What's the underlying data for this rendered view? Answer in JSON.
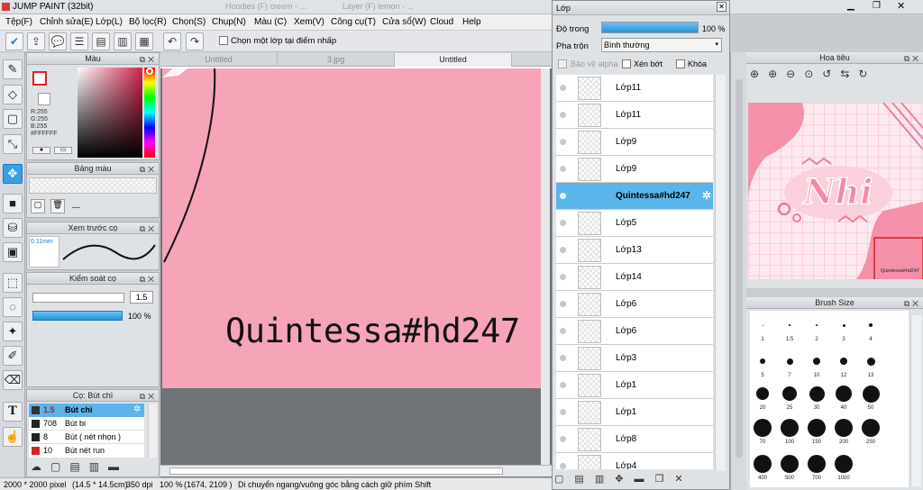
{
  "window": {
    "title": "JUMP PAINT (32bit)"
  },
  "background_tabs": [
    "Hoodies (F) creem - ...",
    "Layer (F) lemon - ..."
  ],
  "menu": [
    "Tệp(F)",
    "Chỉnh sửa(E)",
    "Lớp(L)",
    "Bộ lọc(R)",
    "Chọn(S)",
    "Chụp(N)",
    "Màu (C)",
    "Xem(V)",
    "Công cụ(T)",
    "Cửa sổ(W)",
    "Cloud",
    "Help"
  ],
  "toolbar": {
    "ref_layer_label": "Chọn một lớp tại điểm nhấp"
  },
  "tools": [
    "pen-tool-icon",
    "eraser-tool-icon",
    "selection-rect-icon",
    "lasso-tool-icon",
    "move-tool-icon",
    "fill-rect-icon",
    "bucket-tool-icon",
    "gradient-tool-icon",
    "select-marquee-icon",
    "lasso-select-icon",
    "magic-wand-icon",
    "select-pen-icon",
    "select-eraser-icon",
    "text-tool-icon",
    "hand-tool-icon"
  ],
  "color_panel": {
    "title": "Màu",
    "r": "R:255",
    "g": "G:255",
    "b": "B:255",
    "hex": "#FFFFFF",
    "primary_color": "#ffffff",
    "secondary_color": "#e02020"
  },
  "palette_panel": {
    "title": "Bảng màu",
    "value": "---"
  },
  "brush_preview": {
    "title": "Xem trước cọ",
    "size_label": "0.11mm"
  },
  "brush_control": {
    "title": "Kiểm soát cọ",
    "size_value": "1.5",
    "opacity_value": "100 %"
  },
  "brush_list": {
    "title": "Cọ: Bút chì",
    "items": [
      {
        "size": "1.5",
        "name": "Bút chì",
        "color": "#333333",
        "selected": true
      },
      {
        "size": "708",
        "name": "Bút bi",
        "color": "#222222",
        "selected": false
      },
      {
        "size": "8",
        "name": "Bút ( nét nhọn )",
        "color": "#222222",
        "selected": false
      },
      {
        "size": "10",
        "name": "Bút nét run",
        "color": "#d82020",
        "selected": false
      }
    ]
  },
  "doc_tabs": [
    "Untitled",
    "3.jpg",
    "Untitled"
  ],
  "canvas": {
    "text": "Quintessa#hd247",
    "page_color": "#f6a4b8"
  },
  "status": {
    "size": "2000 * 2000 pixel",
    "cm": "(14.5 * 14.5cm)",
    "dpi": "350 dpi",
    "zoom": "100 %",
    "coords": "(1674, 2109 )",
    "hint": "Di chuyển ngang/vuông góc bằng cách giữ phím Shift"
  },
  "layer_panel": {
    "title": "Lớp",
    "opacity_label": "Độ trong",
    "opacity_value": "100 %",
    "opacity_level": 1.0,
    "blend_label": "Pha trộn",
    "blend_value": "Bình thường",
    "protect_alpha": "Bảo vệ alpha",
    "clip": "Xén bớt",
    "lock": "Khóa",
    "layers": [
      {
        "name": "Lớp11",
        "selected": false
      },
      {
        "name": "Lớp11",
        "selected": false
      },
      {
        "name": "Lớp9",
        "selected": false
      },
      {
        "name": "Lớp9",
        "selected": false
      },
      {
        "name": "Quintessa#hd247",
        "selected": true
      },
      {
        "name": "Lớp5",
        "selected": false
      },
      {
        "name": "Lớp13",
        "selected": false
      },
      {
        "name": "Lớp14",
        "selected": false
      },
      {
        "name": "Lớp6",
        "selected": false
      },
      {
        "name": "Lớp6",
        "selected": false
      },
      {
        "name": "Lớp3",
        "selected": false
      },
      {
        "name": "Lớp1",
        "selected": false
      },
      {
        "name": "Lớp1",
        "selected": false
      },
      {
        "name": "Lớp8",
        "selected": false
      },
      {
        "name": "Lớp4",
        "selected": false
      }
    ]
  },
  "navigator": {
    "title": "Hoa tiêu",
    "preview_text": "Nhi",
    "preview_small_text": "Quintessa#hd247"
  },
  "brush_size": {
    "title": "Brush Size",
    "sizes": [
      "1",
      "1.5",
      "2",
      "3",
      "4",
      "5",
      "7",
      "10",
      "12",
      "13",
      "20",
      "25",
      "30",
      "40",
      "50",
      "70",
      "100",
      "150",
      "200",
      "250",
      "400",
      "500",
      "700",
      "1000"
    ]
  }
}
